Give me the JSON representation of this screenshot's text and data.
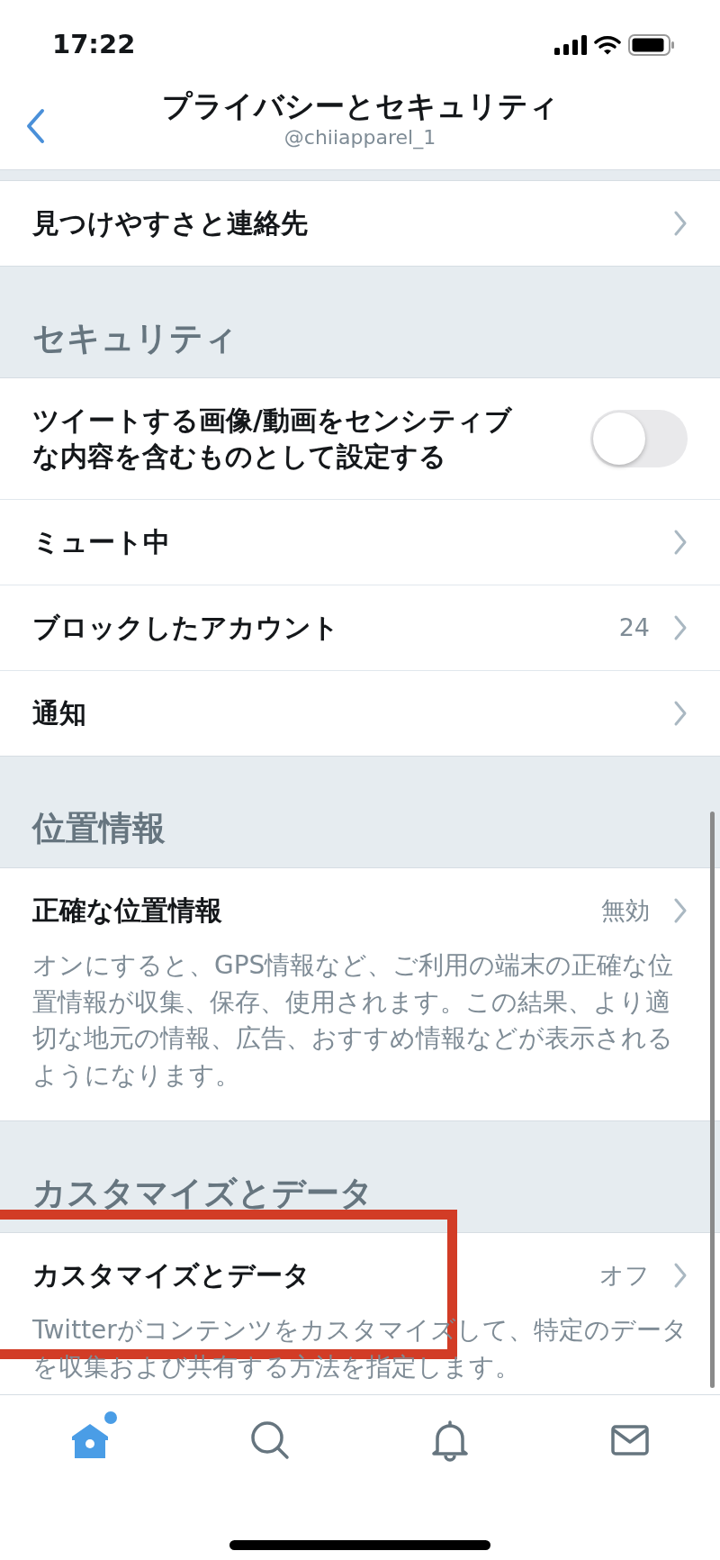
{
  "status_bar": {
    "time": "17:22"
  },
  "header": {
    "title": "プライバシーとセキュリティ",
    "subtitle": "@chiiapparel_1"
  },
  "sections": [
    {
      "rows": [
        {
          "kind": "link",
          "label": "見つけやすさと連絡先",
          "highlighted": false
        }
      ]
    },
    {
      "heading": "セキュリティ",
      "rows": [
        {
          "kind": "toggle",
          "label": "ツイートする画像/動画をセンシティブな内容を含むものとして設定する",
          "on": false,
          "highlighted": false
        },
        {
          "kind": "link",
          "label": "ミュート中",
          "highlighted": false
        },
        {
          "kind": "link",
          "label": "ブロックしたアカウント",
          "value": "24",
          "highlighted": false
        },
        {
          "kind": "link",
          "label": "通知",
          "highlighted": false
        }
      ]
    },
    {
      "heading": "位置情報",
      "rows": [
        {
          "kind": "link",
          "label": "正確な位置情報",
          "value": "無効",
          "description": "オンにすると、GPS情報など、ご利用の端末の正確な位置情報が収集、保存、使用されます。この結果、より適切な地元の情報、広告、おすすめ情報などが表示されるようになります。",
          "highlighted": false
        }
      ]
    },
    {
      "heading": "カスタマイズとデータ",
      "rows": [
        {
          "kind": "link",
          "label": "カスタマイズとデータ",
          "value": "オフ",
          "description": "Twitterがコンテンツをカスタマイズして、特定のデータを収集および共有する方法を指定します。",
          "highlighted": true
        }
      ]
    }
  ],
  "tabs": [
    {
      "kind": "home",
      "selected": true,
      "has_new": true
    },
    {
      "kind": "search",
      "selected": false,
      "has_new": false
    },
    {
      "kind": "notifications",
      "selected": false,
      "has_new": false
    },
    {
      "kind": "messages",
      "selected": false,
      "has_new": false
    }
  ]
}
